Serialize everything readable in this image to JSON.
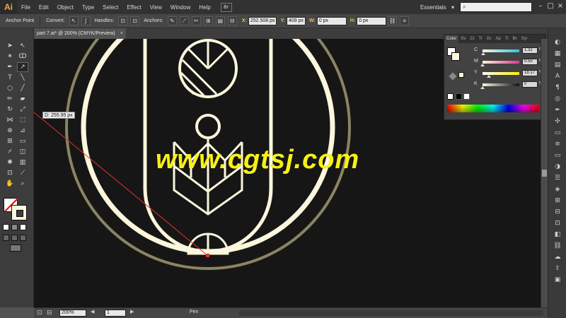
{
  "app": {
    "logo": "Ai"
  },
  "menu": {
    "items": [
      "File",
      "Edit",
      "Object",
      "Type",
      "Select",
      "Effect",
      "View",
      "Window",
      "Help"
    ],
    "bridge": "Br",
    "workspace": "Essentials",
    "workspace_arrow": "▾"
  },
  "window_controls": {
    "minimize": "–",
    "restore": "□",
    "close": "×"
  },
  "control_bar": {
    "tool_name": "Anchor Point",
    "convert_label": "Convert:",
    "handles_label": "Handles:",
    "anchors_label": "Anchors:",
    "x_label": "X:",
    "x_value": "252.508 px",
    "y_label": "Y:",
    "y_value": "409 px",
    "w_label": "W:",
    "w_value": "0 px",
    "h_label": "H:",
    "h_value": "0 px"
  },
  "document": {
    "tab_title": "part 7.ai* @ 200% (CMYK/Preview)",
    "close": "×"
  },
  "canvas": {
    "tooltip": "D: 255.95 px",
    "watermark": "www.cgtsj.com"
  },
  "status_bar": {
    "zoom": "200%",
    "page": "1",
    "active_tool": "Pen"
  },
  "color_panel": {
    "tabs": [
      "Color",
      "Sv",
      "Ct",
      "Tr",
      "Gr",
      "Ap",
      "Ti",
      "Br",
      "Syi"
    ],
    "channels": [
      {
        "label": "C",
        "value": "1.32",
        "unit": "%",
        "fraction": 0.0132
      },
      {
        "label": "M",
        "value": "0.55",
        "unit": "%",
        "fraction": 0.0055
      },
      {
        "label": "Y",
        "value": "18.17",
        "unit": "%",
        "fraction": 0.1817
      },
      {
        "label": "K",
        "value": "0",
        "unit": "%",
        "fraction": 0
      }
    ]
  },
  "colors": {
    "artwork_stroke": "#fbf6dc",
    "outer_ring": "#8a8462",
    "path_line": "#e03030",
    "watermark": "#f7f116",
    "canvas_bg": "#161616"
  }
}
